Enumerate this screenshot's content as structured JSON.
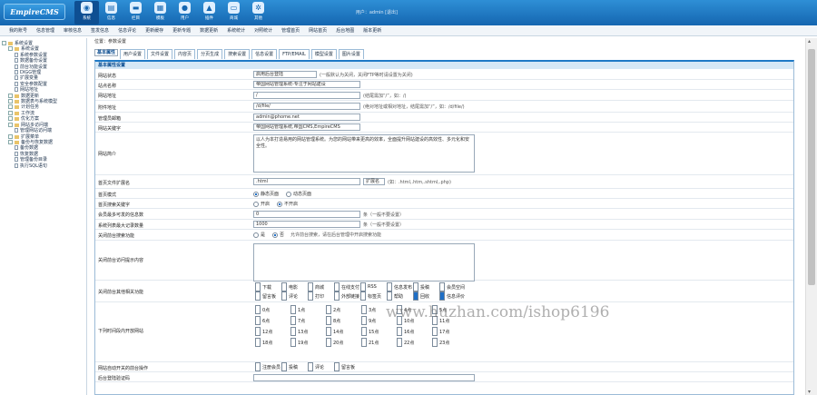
{
  "logo": "EmpireCMS",
  "topnav": [
    {
      "label": "系统",
      "icon": "globe-icon",
      "active": true
    },
    {
      "label": "信息",
      "icon": "document-icon"
    },
    {
      "label": "栏目",
      "icon": "folder-icon"
    },
    {
      "label": "模板",
      "icon": "template-icon"
    },
    {
      "label": "用户",
      "icon": "user-icon"
    },
    {
      "label": "插件",
      "icon": "plugin-icon"
    },
    {
      "label": "商城",
      "icon": "shop-icon"
    },
    {
      "label": "其他",
      "icon": "gear-icon"
    }
  ],
  "user_info": "用户：admin  [退出]",
  "subnav": [
    "我的账号",
    "信息管理",
    "审核信息",
    "签发信息",
    "信息评论",
    "更新缓存",
    "更新专题",
    "数据更新",
    "系统统计",
    "对照统计",
    "管理首页",
    "网站首页",
    "后台地图",
    "版本更新"
  ],
  "sidebar": [
    {
      "t": "系统设置",
      "lvl": 0,
      "type": "n"
    },
    {
      "t": "系统设置",
      "lvl": 1,
      "type": "n"
    },
    {
      "t": "系统参数设置",
      "lvl": 2,
      "type": "p"
    },
    {
      "t": "数据备份设置",
      "lvl": 2,
      "type": "p"
    },
    {
      "t": "前台功能设置",
      "lvl": 2,
      "type": "p"
    },
    {
      "t": "DIGG管理",
      "lvl": 2,
      "type": "p"
    },
    {
      "t": "扩展变量",
      "lvl": 2,
      "type": "p"
    },
    {
      "t": "安全参数配置",
      "lvl": 2,
      "type": "p"
    },
    {
      "t": "网站地址",
      "lvl": 2,
      "type": "p"
    },
    {
      "t": "数据更新",
      "lvl": 1,
      "type": "n"
    },
    {
      "t": "数据表与系统模型",
      "lvl": 1,
      "type": "n"
    },
    {
      "t": "计划任务",
      "lvl": 1,
      "type": "n"
    },
    {
      "t": "工作流",
      "lvl": 1,
      "type": "n"
    },
    {
      "t": "优化方案",
      "lvl": 1,
      "type": "n"
    },
    {
      "t": "网站多访问端",
      "lvl": 1,
      "type": "n"
    },
    {
      "t": "管理网站访问端",
      "lvl": 2,
      "type": "p"
    },
    {
      "t": "扩展菜单",
      "lvl": 1,
      "type": "n"
    },
    {
      "t": "备份与恢复数据",
      "lvl": 1,
      "type": "n"
    },
    {
      "t": "备份数据",
      "lvl": 2,
      "type": "p"
    },
    {
      "t": "恢复数据",
      "lvl": 2,
      "type": "p"
    },
    {
      "t": "管理备份目录",
      "lvl": 2,
      "type": "p"
    },
    {
      "t": "执行SQL语句",
      "lvl": 2,
      "type": "p"
    }
  ],
  "breadcrumb": "位置：参数设置",
  "tabs": [
    "基本属性",
    "用户设置",
    "文件设置",
    "内容页",
    "分页生成",
    "搜索设置",
    "信息设置",
    "FTP/EMAIL",
    "模型设置",
    "图片设置"
  ],
  "panel_title": "基本属性设置",
  "form": {
    "r1": {
      "label": "网站状态",
      "select": "启用后台登陆",
      "hint": "(一般默认为关闭，关闭FTP等时请设置为关闭)"
    },
    "r2": {
      "label": "站点名称",
      "value": "帝国网站管理系统-专注于网站建设"
    },
    "r3": {
      "label": "网站地址",
      "value": "/",
      "hint": "(结尾需加“/”，如：/)"
    },
    "r4": {
      "label": "附件地址",
      "value": "/d/file/",
      "hint": "(绝对地址或相对地址，结尾需加“/”，如：/d/file/)"
    },
    "r5": {
      "label": "管理员邮箱",
      "value": "admin@phome.net"
    },
    "r6": {
      "label": "网站关键字",
      "value": "帝国网站管理系统,帝国CMS,EmpireCMS"
    },
    "r7": {
      "label": "网站简介",
      "value": "以人为本打造易用的网站管理系统。为您的网站带来更高的效率，全面提升网站建设的高效性、多元化和安全性。"
    },
    "r8": {
      "label": "首页文件扩展名",
      "value": ".html",
      "select": "扩展名",
      "hint": "(如：.html,.htm,.shtml,.php)"
    },
    "r9": {
      "label": "首页模式",
      "opts": [
        "静态页面",
        "动态页面"
      ],
      "on": 0
    },
    "r10": {
      "label": "首页搜索关键字",
      "opts": [
        "开启",
        "不开启"
      ],
      "on": 1
    },
    "r11": {
      "label": "会员最多可发的信息数",
      "value": "0",
      "hint": "条（一般不要设置）"
    },
    "r12": {
      "label": "系统列表最大记录数量",
      "value": "1000",
      "hint": "条（一般不要设置）"
    },
    "r13": {
      "label": "关闭前台搜索功能",
      "opts": [
        "是",
        "否"
      ],
      "on": 1,
      "hint": "允许前台搜索，请在后台管理中开启搜索功能"
    },
    "r14": {
      "label": "关闭前台访问提示内容"
    },
    "r15": {
      "label": "关闭前台其他相关功能",
      "items": [
        "下载",
        "电影",
        "商城",
        "在线支付",
        "RSS",
        "信息发布",
        "投稿",
        "会员空间",
        "留言板",
        "评论",
        "打印",
        "外部链接",
        "标签页",
        "帮助",
        "回收",
        "信息评价"
      ],
      "checked": [
        14,
        15
      ]
    },
    "r16": {
      "label": "下列时间段内开放网站",
      "hours": [
        "0点",
        "1点",
        "2点",
        "3点",
        "4点",
        "5点",
        "6点",
        "7点",
        "8点",
        "9点",
        "10点",
        "11点",
        "12点",
        "13点",
        "14点",
        "15点",
        "16点",
        "17点",
        "18点",
        "19点",
        "20点",
        "21点",
        "22点",
        "23点"
      ]
    },
    "r17": {
      "label": "网站自动开关的前台操作",
      "items": [
        "注册会员",
        "投稿",
        "评论",
        "留言板"
      ]
    },
    "r18": {
      "label": "后台登陆验证码"
    }
  },
  "watermark": "www.huzhan.com/ishop6196"
}
